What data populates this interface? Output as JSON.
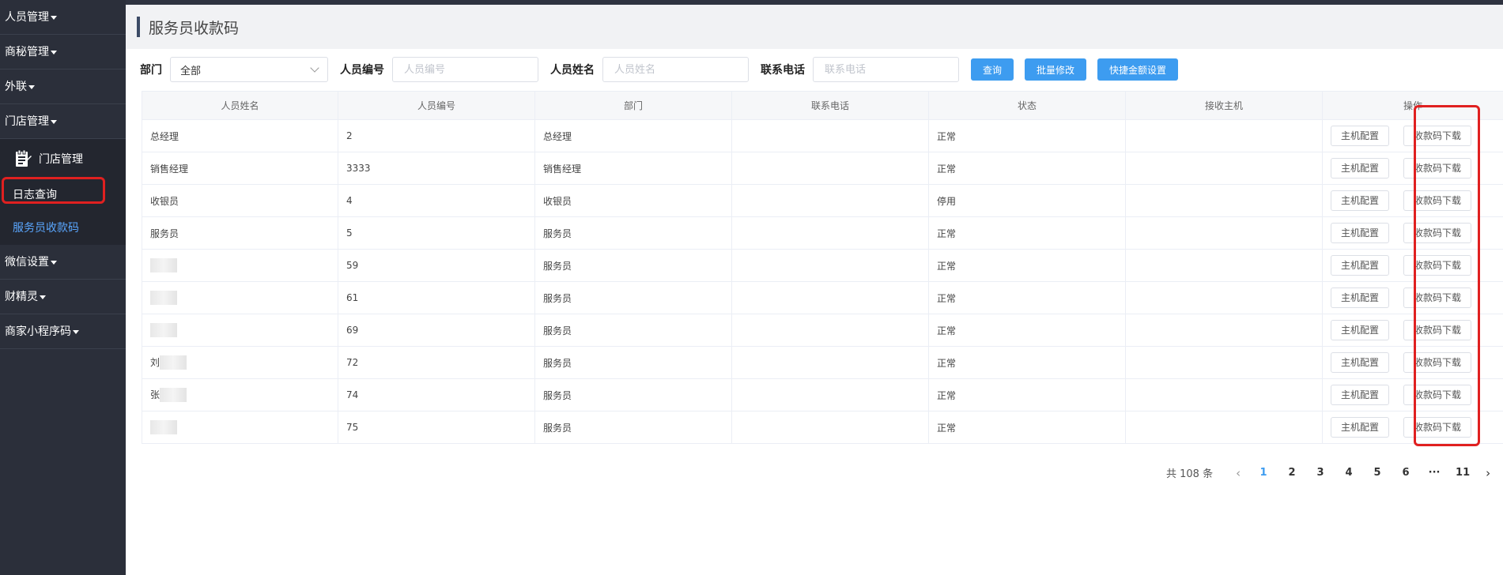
{
  "sidebar": {
    "menus_top": [
      {
        "label": "人员管理"
      },
      {
        "label": "商秘管理"
      },
      {
        "label": "外联"
      },
      {
        "label": "门店管理"
      }
    ],
    "submenu": {
      "head": "门店管理",
      "items": [
        {
          "label": "日志查询"
        },
        {
          "label": "服务员收款码"
        }
      ]
    },
    "menus_bottom": [
      {
        "label": "微信设置"
      },
      {
        "label": "财精灵"
      },
      {
        "label": "商家小程序码"
      }
    ]
  },
  "page": {
    "title": "服务员收款码"
  },
  "filters": {
    "dept_label": "部门",
    "dept_value": "全部",
    "code_label": "人员编号",
    "code_placeholder": "人员编号",
    "name_label": "人员姓名",
    "name_placeholder": "人员姓名",
    "phone_label": "联系电话",
    "phone_placeholder": "联系电话",
    "query_btn": "查询",
    "batch_btn": "批量修改",
    "quick_btn": "快捷金额设置"
  },
  "table": {
    "headers": [
      "人员姓名",
      "人员编号",
      "部门",
      "联系电话",
      "状态",
      "接收主机",
      "操作"
    ],
    "config_btn": "主机配置",
    "download_btn": "收款码下载",
    "rows": [
      {
        "name": "总经理",
        "code": "2",
        "dept": "总经理",
        "phone": "",
        "status": "正常",
        "host": ""
      },
      {
        "name": "销售经理",
        "code": "3333",
        "dept": "销售经理",
        "phone": "",
        "status": "正常",
        "host": ""
      },
      {
        "name": "收银员",
        "code": "4",
        "dept": "收银员",
        "phone": "",
        "status": "停用",
        "host": ""
      },
      {
        "name": "服务员",
        "code": "5",
        "dept": "服务员",
        "phone": "",
        "status": "正常",
        "host": ""
      },
      {
        "name": "",
        "code": "59",
        "dept": "服务员",
        "phone": "",
        "status": "正常",
        "host": ""
      },
      {
        "name": "",
        "code": "61",
        "dept": "服务员",
        "phone": "",
        "status": "正常",
        "host": ""
      },
      {
        "name": "",
        "code": "69",
        "dept": "服务员",
        "phone": "",
        "status": "正常",
        "host": ""
      },
      {
        "name": "刘",
        "code": "72",
        "dept": "服务员",
        "phone": "",
        "status": "正常",
        "host": ""
      },
      {
        "name": "张",
        "code": "74",
        "dept": "服务员",
        "phone": "",
        "status": "正常",
        "host": ""
      },
      {
        "name": "",
        "code": "75",
        "dept": "服务员",
        "phone": "",
        "status": "正常",
        "host": ""
      }
    ]
  },
  "pager": {
    "total": "共 108 条",
    "pages": [
      "1",
      "2",
      "3",
      "4",
      "5",
      "6",
      "···",
      "11"
    ],
    "current": "1"
  },
  "colors": {
    "sidebar_bg": "#2b2f3a",
    "accent": "#3d9cf0",
    "highlight": "#e02020"
  }
}
